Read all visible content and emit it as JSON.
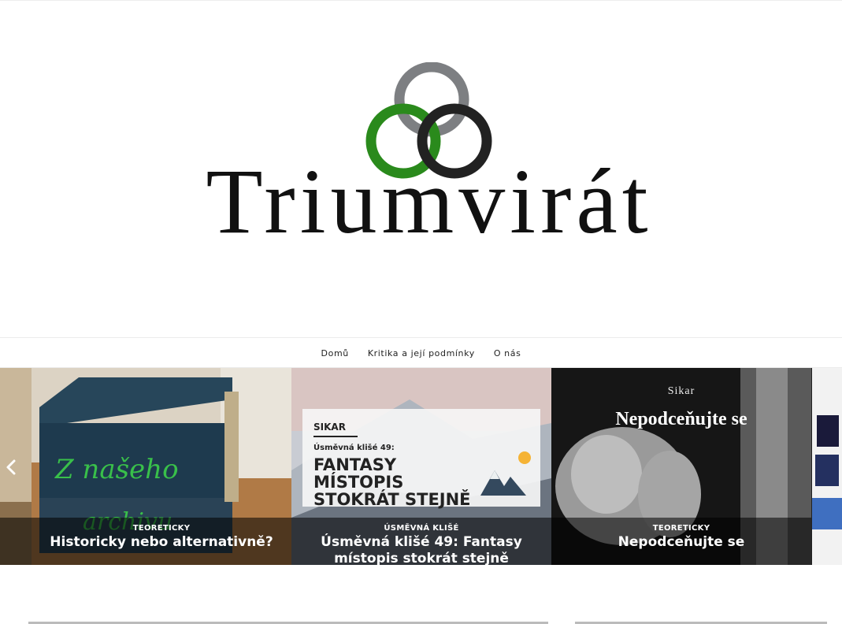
{
  "site": {
    "logo_text": "Triumvirát",
    "ring_colors": [
      "#7d7f82",
      "#2a8a1c",
      "#222222"
    ]
  },
  "nav": {
    "items": [
      "Domů",
      "Kritika a její podmínky",
      "O nás"
    ]
  },
  "slider": {
    "slides": [
      {
        "category": "TEORETICKY",
        "title": "Historicky nebo alternativně?",
        "image_text": [
          "Z našeho",
          "archivu"
        ]
      },
      {
        "category": "ÚSMĚVNÁ KLIŠÉ",
        "title": "Úsměvná klišé 49: Fantasy místopis stokrát stejně",
        "poster_author": "SIKAR",
        "poster_series": "Úsměvná klišé 49:",
        "poster_headline": "FANTASY MÍSTOPIS STOKRÁT STEJNĚ"
      },
      {
        "category": "TEORETICKY",
        "title": "Nepodceňujte se",
        "image_author": "Sikar",
        "image_headline": "Nepodceňujte se"
      }
    ]
  },
  "colors": {
    "accent_green": "#2a8a1c",
    "caption_overlay": "rgba(0,0,0,0.55)"
  }
}
